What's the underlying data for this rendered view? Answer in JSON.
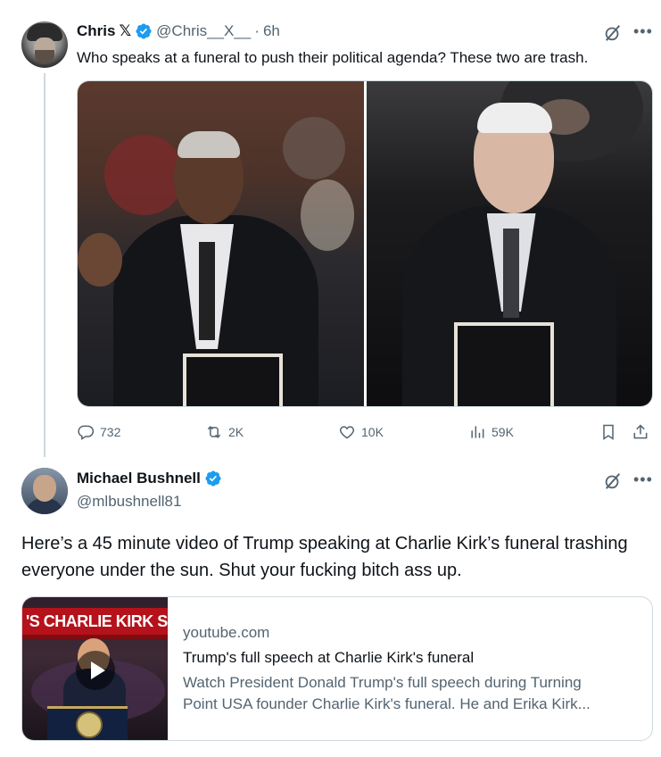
{
  "tweet1": {
    "author_name": "Chris",
    "author_x_icon": "𝕏",
    "handle": "@Chris__X__",
    "separator": "·",
    "time": "6h",
    "text": "Who speaks at a funeral to push their political agenda? These two are trash.",
    "actions": {
      "replies": "732",
      "reposts": "2K",
      "likes": "10K",
      "views": "59K"
    }
  },
  "tweet2": {
    "author_name": "Michael Bushnell",
    "handle": "@mlbushnell81",
    "text": "Here’s a 45 minute video of Trump speaking at Charlie Kirk’s funeral trashing everyone under the sun.  Shut your fucking bitch ass up.",
    "card": {
      "banner_text": "'S CHARLIE KIRK SI",
      "domain": "youtube.com",
      "title": "Trump's full speech at Charlie Kirk's funeral",
      "description_line1": "Watch President Donald Trump's full speech during Turning",
      "description_line2": "Point USA founder Charlie Kirk's funeral. He and Erika Kirk..."
    }
  },
  "icons": [
    "verified-badge-icon",
    "grok-icon",
    "more-icon",
    "reply-icon",
    "repost-icon",
    "like-icon",
    "views-icon",
    "bookmark-icon",
    "share-icon",
    "play-icon"
  ],
  "colors": {
    "text": "#0f1419",
    "secondary": "#536471",
    "verified": "#1d9bf0",
    "border": "#cfd9de",
    "youtube_red": "#b5121b"
  }
}
